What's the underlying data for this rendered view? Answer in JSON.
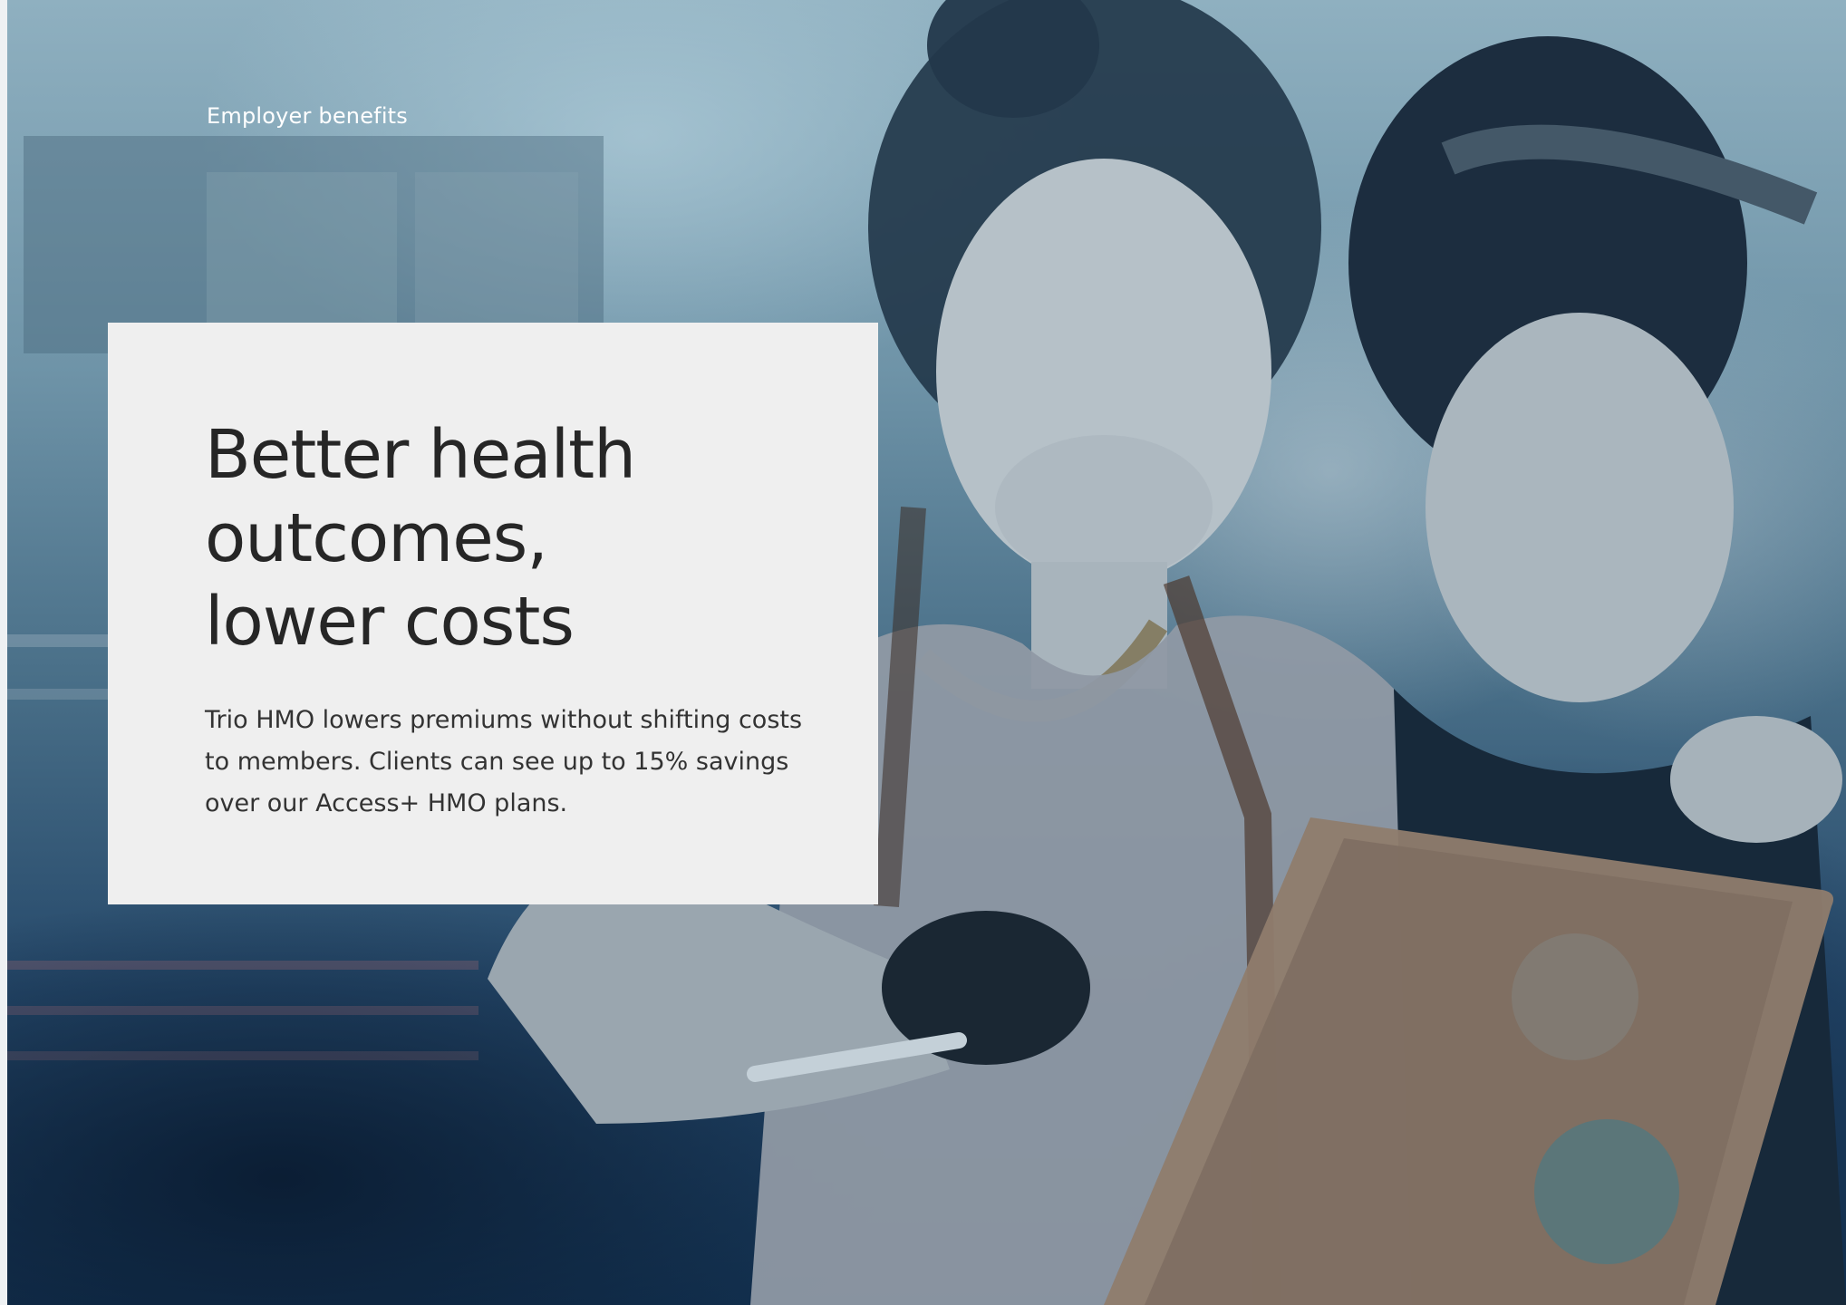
{
  "header": {
    "kicker": "Employer benefits"
  },
  "card": {
    "headline": "Better health outcomes,\nlower costs",
    "body": "Trio HMO lowers premiums without shifting costs to members. Clients can see up to 15% savings over our Access+ HMO plans."
  }
}
